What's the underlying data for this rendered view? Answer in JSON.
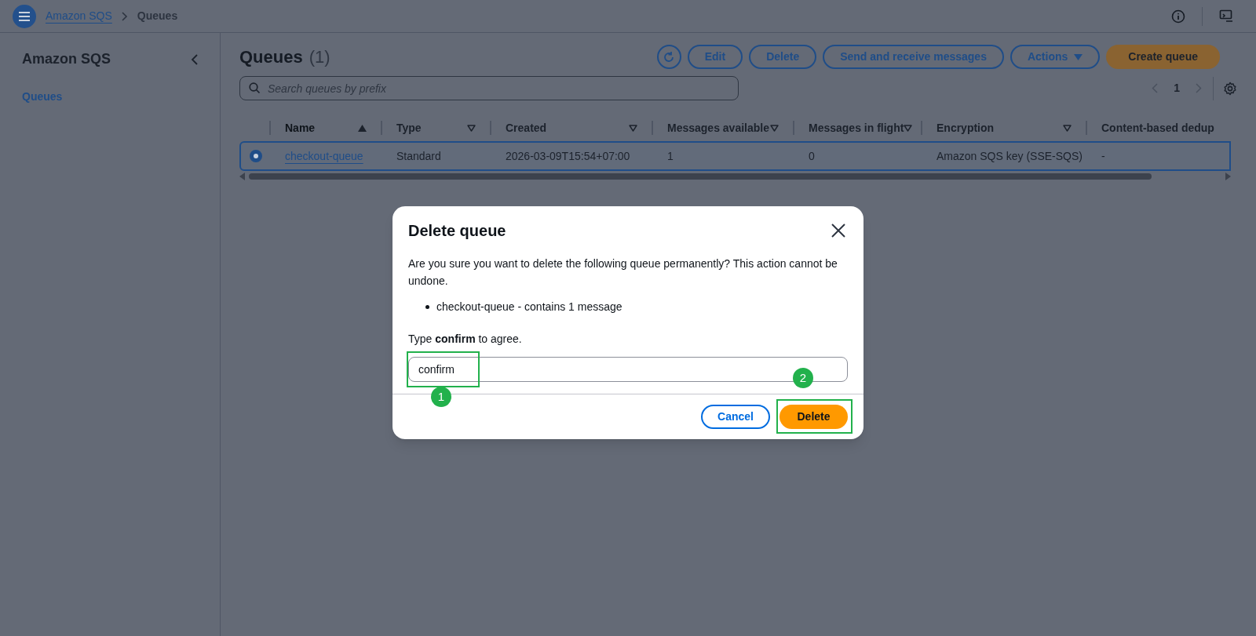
{
  "breadcrumb": [
    {
      "label": "Amazon SQS",
      "link": true
    },
    {
      "label": "Queues",
      "link": false
    }
  ],
  "sidebar": {
    "title": "Amazon SQS",
    "items": [
      {
        "label": "Queues",
        "selected": true
      }
    ]
  },
  "page": {
    "title": "Queues",
    "count": "(1)"
  },
  "toolbar": {
    "buttons": [
      {
        "label": "Edit",
        "kind": "normal"
      },
      {
        "label": "Delete",
        "kind": "normal"
      },
      {
        "label": "Send and receive messages",
        "kind": "normal"
      },
      {
        "label": "Actions",
        "kind": "dropdown"
      },
      {
        "label": "Create queue",
        "kind": "primary"
      }
    ]
  },
  "search": {
    "placeholder": "Search queues by prefix"
  },
  "pagination": {
    "page": "1"
  },
  "table": {
    "columns": [
      {
        "label": "Name",
        "sorted": true
      },
      {
        "label": "Type",
        "sorted": false
      },
      {
        "label": "Created",
        "sorted": false
      },
      {
        "label": "Messages available",
        "sorted": false
      },
      {
        "label": "Messages in flight",
        "sorted": false
      },
      {
        "label": "Encryption",
        "sorted": false
      },
      {
        "label": "Content-based dedup",
        "sorted": false
      }
    ],
    "rows": [
      {
        "selected": true,
        "cells": [
          "checkout-queue",
          "Standard",
          "2026-03-09T15:54+07:00",
          "1",
          "0",
          "Amazon SQS key (SSE-SQS)",
          "-"
        ]
      }
    ]
  },
  "dialog": {
    "title": "Delete queue",
    "message": "Are you sure you want to delete the following queue permanently? This action cannot be undone.",
    "items": [
      "checkout-queue - contains 1 message"
    ],
    "instruction": "Type **confirm** to agree.",
    "input_value": "confirm",
    "buttons": [
      {
        "label": "Cancel",
        "kind": "normal"
      },
      {
        "label": "Delete",
        "kind": "primary"
      }
    ]
  },
  "annotations": [
    {
      "label": "1"
    },
    {
      "label": "2"
    }
  ]
}
